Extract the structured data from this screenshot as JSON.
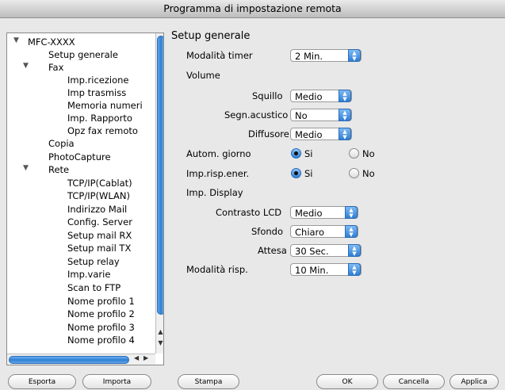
{
  "window": {
    "title": "Programma di impostazione remota"
  },
  "tree": {
    "root": "MFC-XXXX",
    "setup_generale": "Setup generale",
    "fax": "Fax",
    "fax_items": [
      "Imp.ricezione",
      "Imp trasmiss",
      "Memoria numeri",
      "Imp. Rapporto",
      "Opz fax remoto"
    ],
    "copia": "Copia",
    "photocapture": "PhotoCapture",
    "rete": "Rete",
    "rete_items": [
      "TCP/IP(Cablat)",
      "TCP/IP(WLAN)",
      "Indirizzo Mail",
      "Config. Server",
      "Setup mail RX",
      "Setup mail TX",
      "Setup relay",
      "Imp.varie",
      "Scan to FTP",
      "Nome profilo 1",
      "Nome profilo 2",
      "Nome profilo 3",
      "Nome profilo 4"
    ]
  },
  "panel": {
    "title": "Setup generale",
    "modalita_timer": {
      "label": "Modalità timer",
      "value": "2 Min."
    },
    "volume": "Volume",
    "squillo": {
      "label": "Squillo",
      "value": "Medio"
    },
    "segn_acustico": {
      "label": "Segn.acustico",
      "value": "No"
    },
    "diffusore": {
      "label": "Diffusore",
      "value": "Medio"
    },
    "autom_giorno": {
      "label": "Autom. giorno",
      "yes": "Si",
      "no": "No",
      "selected": "Si"
    },
    "imp_risp_ener": {
      "label": "Imp.risp.ener.",
      "yes": "Si",
      "no": "No",
      "selected": "Si"
    },
    "imp_display": "Imp. Display",
    "contrasto_lcd": {
      "label": "Contrasto LCD",
      "value": "Medio"
    },
    "sfondo": {
      "label": "Sfondo",
      "value": "Chiaro"
    },
    "attesa": {
      "label": "Attesa",
      "value": "30 Sec."
    },
    "modalita_risp": {
      "label": "Modalità risp.",
      "value": "10 Min."
    }
  },
  "buttons": {
    "esporta": "Esporta",
    "importa": "Importa",
    "stampa": "Stampa",
    "ok": "OK",
    "cancella": "Cancella",
    "applica": "Applica"
  }
}
